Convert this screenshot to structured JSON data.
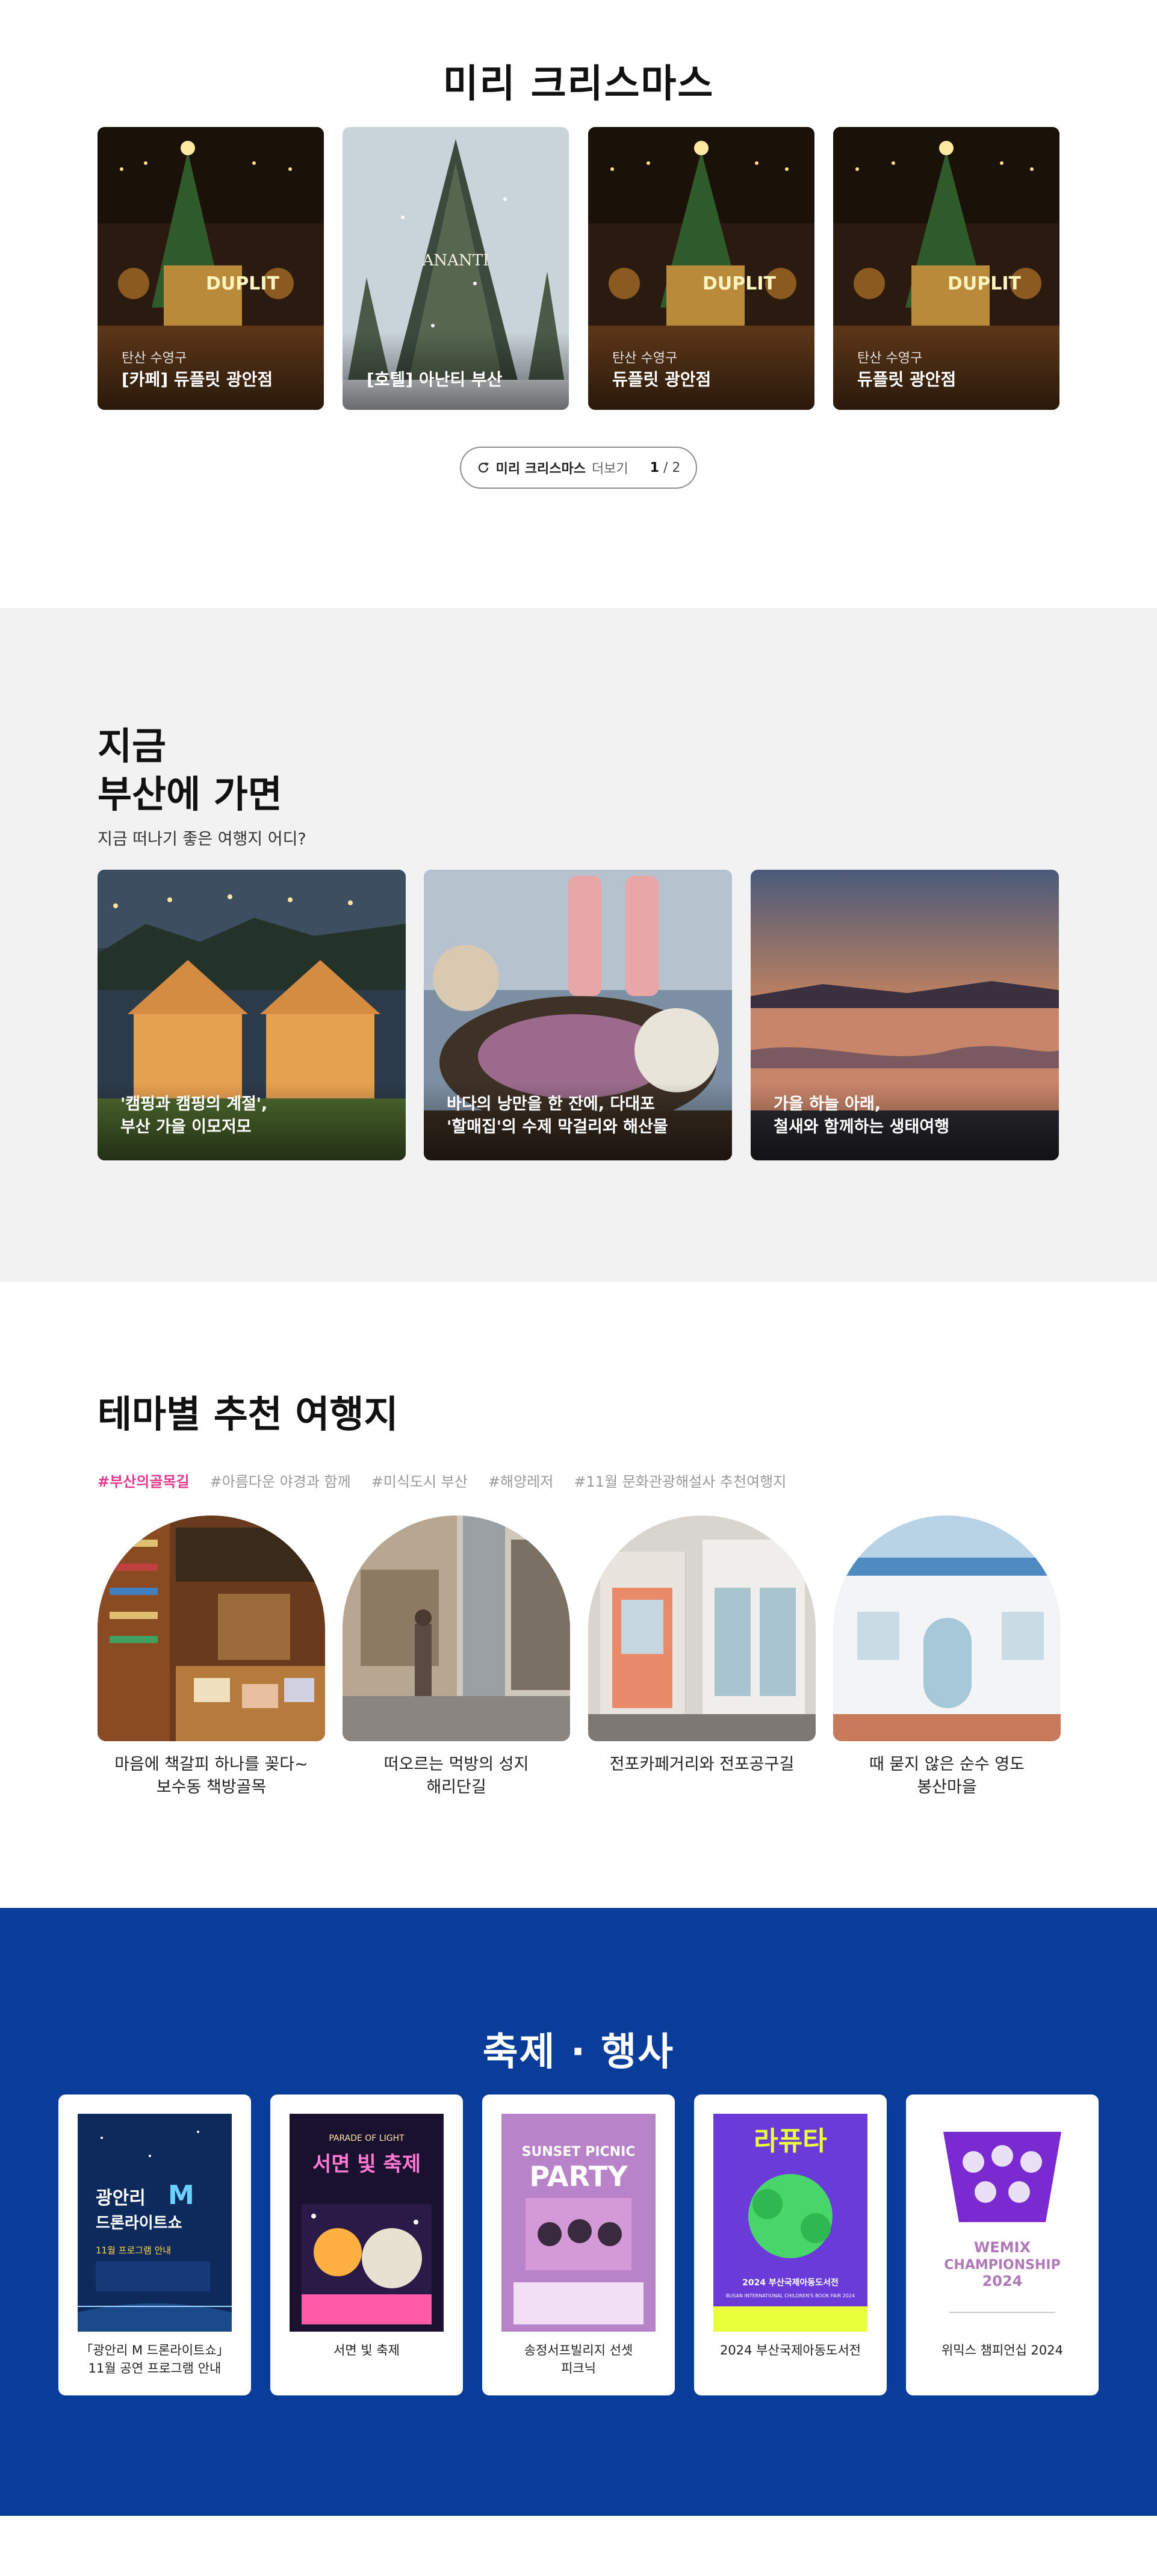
{
  "xmas": {
    "title": "미리 크리스마스",
    "cards": [
      {
        "small": "탄산 수영구",
        "caption": "[카페] 듀플릿 광안점"
      },
      {
        "small": "",
        "caption": "[호텔] 아난티 부산"
      },
      {
        "small": "탄산 수영구",
        "caption": "듀플릿 광안점"
      },
      {
        "small": "탄산 수영구",
        "caption": "듀플릿 광안점"
      }
    ],
    "more": {
      "strong": "미리 크리스마스",
      "light": "더보기",
      "current": "1",
      "total": "/ 2"
    },
    "logo_text": [
      "DUPLIT",
      "ANANTI"
    ]
  },
  "now": {
    "title_line1": "지금",
    "title_line2": "부산에 가면",
    "subtitle": "지금 떠나기 좋은 여행지 어디?",
    "cards": [
      {
        "line1": "'캠핑과 캠핑의 계절',",
        "line2": "부산 가을 이모저모"
      },
      {
        "line1": "바다의 낭만을 한 잔에, 다대포",
        "line2": "'할매집'의 수제 막걸리와 해산물"
      },
      {
        "line1": "가을 하늘 아래,",
        "line2": "철새와 함께하는 생태여행"
      }
    ]
  },
  "theme": {
    "title": "테마별 추천 여행지",
    "tags": [
      "#부산의골목길",
      "#아름다운 야경과 함께",
      "#미식도시 부산",
      "#해양레저",
      "#11월 문화관광해설사 추천여행지"
    ],
    "cards": [
      {
        "line1": "마음에 책갈피 하나를 꽂다~",
        "line2": "보수동 책방골목"
      },
      {
        "line1": "떠오르는 먹방의 성지",
        "line2": "해리단길"
      },
      {
        "line1": "전포카페거리와 전포공구길",
        "line2": ""
      },
      {
        "line1": "때 묻지 않은 순수 영도",
        "line2": "봉산마을"
      }
    ]
  },
  "fest": {
    "title": "축제 · 행사",
    "cards": [
      {
        "line1": "「광안리 M 드론라이트쇼」",
        "line2": "11월 공연 프로그램 안내"
      },
      {
        "line1": "서면 빛 축제",
        "line2": ""
      },
      {
        "line1": "송정서프빌리지 선셋",
        "line2": "피크닉"
      },
      {
        "line1": "2024 부산국제아동도서전",
        "line2": ""
      },
      {
        "line1": "위믹스 챔피언십 2024",
        "line2": ""
      }
    ],
    "posters": {
      "drone": {
        "l1": "광안리",
        "l2": "M",
        "l3": "드론라이트쇼",
        "l4": "11월 프로그램 안내"
      },
      "light": {
        "l1": "PARADE OF LIGHT",
        "l2": "서면 빛 축제"
      },
      "sunset": {
        "l1": "SUNSET PICNIC",
        "l2": "PARTY"
      },
      "book": {
        "l1": "라퓨타",
        "l2": "2024 부산국제아동도서전",
        "l3": "BUSAN INTERNATIONAL CHILDREN'S BOOK FAIR 2024"
      },
      "wemix": {
        "l1": "WEMIX",
        "l2": "CHAMPIONSHIP",
        "l3": "2024"
      }
    }
  },
  "colors": {
    "section_gray": "#f2f2f2",
    "festival_blue": "#0a3d9a",
    "tag_active": "#e23a8c"
  }
}
